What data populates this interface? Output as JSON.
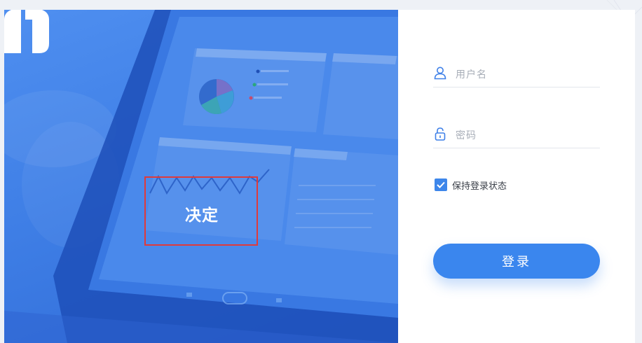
{
  "brand": {
    "name": "决定",
    "logo": "f-logo"
  },
  "login": {
    "username_label": "用户名",
    "password_label": "密码",
    "remember_label": "保持登录状态",
    "remember_checked": true,
    "submit_label": "登录"
  },
  "icons": {
    "username": "user-icon",
    "password": "lock-icon",
    "remember": "check-icon"
  },
  "colors": {
    "accent": "#3a86ee",
    "hero": "#3f7fe6",
    "highlight": "#e03a3a"
  }
}
